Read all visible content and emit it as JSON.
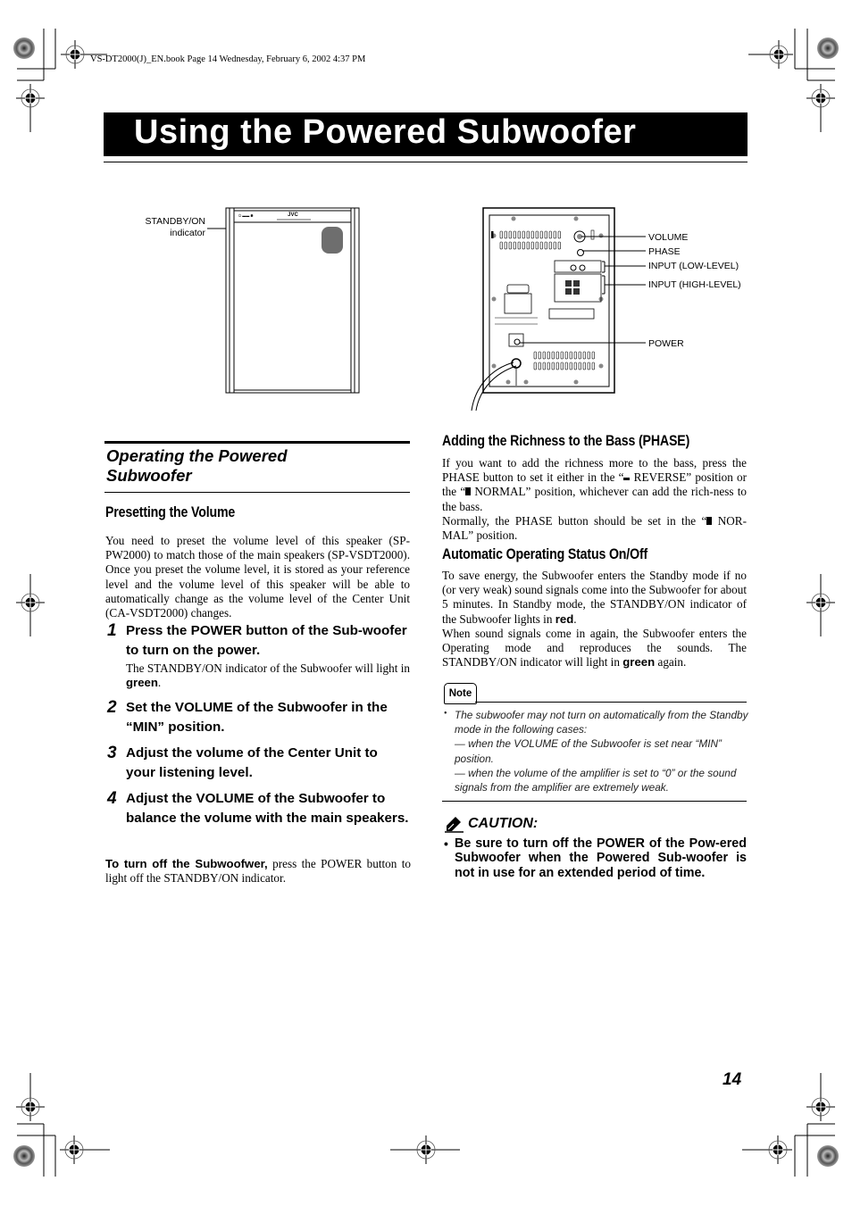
{
  "header": {
    "file_line": "VS-DT2000(J)_EN.book  Page 14  Wednesday, February 6, 2002  4:37 PM"
  },
  "page": {
    "title": "Using the Powered Subwoofer",
    "number": "14"
  },
  "figures": {
    "front": {
      "label_line1": "STANDBY/ON",
      "label_line2": "indicator",
      "brand": "JVC"
    },
    "rear": {
      "labels": [
        "VOLUME",
        "PHASE",
        "INPUT (LOW-LEVEL)",
        "INPUT (HIGH-LEVEL)",
        "POWER"
      ]
    }
  },
  "left": {
    "section_heading_line1": "Operating the Powered",
    "section_heading_line2": "Subwoofer",
    "presetting": {
      "heading": "Presetting the Volume",
      "body": "You need to preset the volume level of this speaker (SP-PW2000) to match those of the main speakers (SP-VSDT2000). Once you preset the volume level, it is stored as your reference level and the volume level of this speaker will be able to automatically change as the volume level of the Center Unit (CA-VSDT2000) changes."
    },
    "steps": [
      {
        "num": "1",
        "text": "Press the POWER button of the Sub-woofer to turn on the power.",
        "detail_prefix": "The STANDBY/ON indicator of the Subwoofer will light in ",
        "detail_bold": "green",
        "detail_suffix": "."
      },
      {
        "num": "2",
        "text": "Set the VOLUME of the Subwoofer in the “MIN” position."
      },
      {
        "num": "3",
        "text": "Adjust the volume of the Center Unit to your listening level."
      },
      {
        "num": "4",
        "text": "Adjust the VOLUME of the Subwoofer to balance the volume with the main speakers."
      }
    ],
    "turn_off": {
      "bold": "To turn off the Subwoofwer,",
      "rest": " press the POWER button to light off the STANDBY/ON indicator."
    }
  },
  "right": {
    "phase": {
      "heading": "Adding the Richness to the Bass (PHASE)",
      "p1_a": "If you want to add the richness more to the bass, press the PHASE button to set it either in the “",
      "p1_b": " REVERSE” position or the “",
      "p1_c": " NORMAL” position, whichever can add the rich-ness to the bass.",
      "p2_a": "Normally, the PHASE button should be set in the “",
      "p2_b": " NOR-MAL” position."
    },
    "auto": {
      "heading": "Automatic Operating Status On/Off",
      "p1_a": "To save energy, the Subwoofer enters the Standby mode if no (or very weak) sound signals come into the Subwoofer for about 5 minutes. In Standby mode, the STANDBY/ON indicator of the Subwoofer lights in ",
      "p1_bold": "red",
      "p1_c": ".",
      "p2_a": "When sound signals come in again, the Subwoofer enters the Operating mode and reproduces the sounds. The STANDBY/ON indicator will light in ",
      "p2_bold": "green",
      "p2_c": " again."
    },
    "note": {
      "badge": "Note",
      "lines": [
        "The subwoofer may not turn on automatically from the Standby mode in the following cases:",
        "— when the VOLUME of the Subwoofer is set near “MIN” position.",
        "— when the volume of the amplifier is set to “0” or the sound signals from the amplifier are extremely weak."
      ]
    },
    "caution": {
      "title": "CAUTION:",
      "text": "Be sure to turn off the POWER of the Pow-ered Subwoofer when the Powered Sub-woofer is not in use for an extended period of time."
    }
  }
}
